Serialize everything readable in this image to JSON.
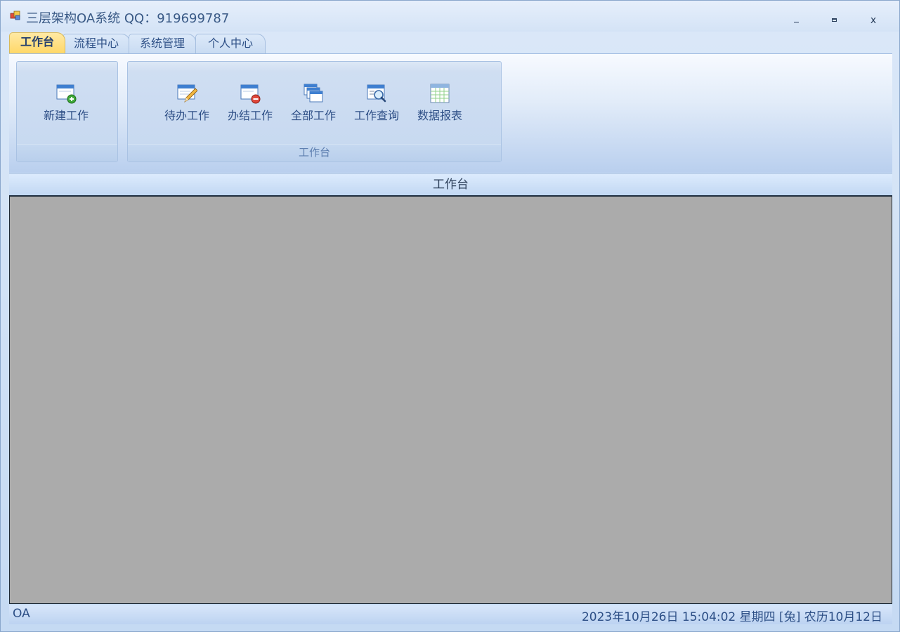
{
  "window": {
    "title": "三层架构OA系统 QQ：919699787",
    "minimize_icon": "minimize-icon",
    "maximize_icon": "maximize-icon",
    "close_label": "x"
  },
  "ribbon": {
    "tabs": [
      {
        "label": "工作台",
        "active": true
      },
      {
        "label": "流程中心",
        "active": false
      },
      {
        "label": "系统管理",
        "active": false
      },
      {
        "label": "个人中心",
        "active": false
      }
    ],
    "groups": [
      {
        "caption": "",
        "buttons": [
          {
            "label": "新建工作",
            "icon": "new-work-icon"
          }
        ]
      },
      {
        "caption": "工作台",
        "buttons": [
          {
            "label": "待办工作",
            "icon": "todo-work-icon"
          },
          {
            "label": "办结工作",
            "icon": "completed-work-icon"
          },
          {
            "label": "全部工作",
            "icon": "all-work-icon"
          },
          {
            "label": "工作查询",
            "icon": "work-query-icon"
          },
          {
            "label": "数据报表",
            "icon": "data-report-icon"
          }
        ]
      }
    ]
  },
  "content": {
    "header_title": "工作台"
  },
  "statusbar": {
    "left": "OA",
    "right": "2023年10月26日 15:04:02 星期四  [兔] 农历10月12日"
  },
  "colors": {
    "active_tab": "#ffd766",
    "content_bg": "#ababab",
    "text_blue": "#2d4f86"
  }
}
